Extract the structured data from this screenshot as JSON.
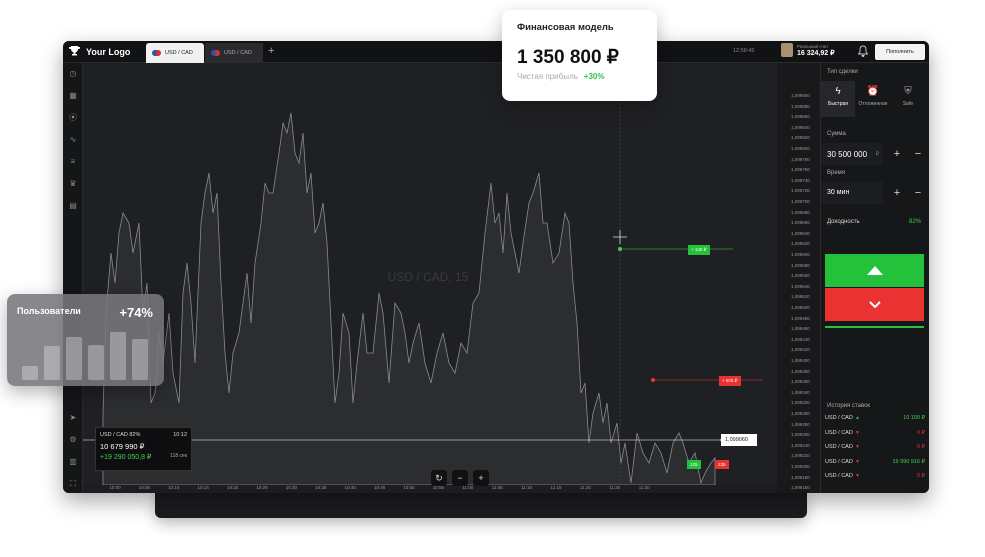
{
  "app": {
    "logo": "Your Logo",
    "tabs": [
      {
        "label": "USD / CAD"
      },
      {
        "label": "USD / CAD"
      }
    ],
    "time": "12:58:45",
    "account": {
      "type": "Реальный счет",
      "balance": "16 324,92 ₽"
    },
    "topup_label": "Пополнить"
  },
  "chart": {
    "watermark": "USD / CAD, 15",
    "current_price": "1,099060",
    "cursor_price": "1,099640",
    "y_labels": [
      "1,099900",
      "1,099880",
      "1,099860",
      "1,099840",
      "1,099820",
      "1,099800",
      "1,099780",
      "1,099760",
      "1,099740",
      "1,099720",
      "1,099700",
      "1,099680",
      "1,099660",
      "1,099640",
      "1,099620",
      "1,099600",
      "1,099580",
      "1,099560",
      "1,099540",
      "1,099520",
      "1,099500",
      "1,099480",
      "1,099460",
      "1,099440",
      "1,099420",
      "1,099400",
      "1,099380",
      "1,099360",
      "1,099340",
      "1,099320",
      "1,099300",
      "1,099280",
      "1,099260",
      "1,099240",
      "1,099220",
      "1,099200",
      "1,099180",
      "1,099160"
    ],
    "x_labels": [
      "10:00",
      "10:05",
      "10:10",
      "10:15",
      "10:20",
      "10:25",
      "10:30",
      "10:35",
      "10:40",
      "10:45",
      "10:50",
      "10:55",
      "11:00",
      "11:05",
      "11:10",
      "11:15",
      "11:20",
      "11:25",
      "11:30"
    ],
    "cursor_time": "11:02:45",
    "tag_green": "+ 130 ₽",
    "tag_red": "+ 500 ₽",
    "mini_tag_1": "125",
    "mini_tag_2": "235"
  },
  "ticker": {
    "pair": "USD / CAD",
    "pct": "82%",
    "time": "10:12",
    "amount": "10 679 990 ₽",
    "profit": "+19 290 050,8 ₽",
    "secs": "118 сек"
  },
  "panel": {
    "deal_type_label": "Тип сделки",
    "deal_types": [
      {
        "label": "Быстрая"
      },
      {
        "label": "Отложенная"
      },
      {
        "label": "Safe"
      }
    ],
    "amount_label": "Сумма",
    "amount_value": "30 500 000",
    "amount_currency": "₽",
    "time_label": "Время",
    "time_value": "30 мин",
    "yield_label": "Доходность",
    "yield_value": "82%",
    "history_label": "История ставок",
    "history": [
      {
        "pair": "USD / CAD",
        "dir": "up",
        "amount": "10 100 ₽",
        "color": "#3fd24f"
      },
      {
        "pair": "USD / CAD",
        "dir": "down",
        "amount": "0 ₽",
        "color": "#ea3232"
      },
      {
        "pair": "USD / CAD",
        "dir": "down",
        "amount": "0 ₽",
        "color": "#ea3232"
      },
      {
        "pair": "USD / CAD",
        "dir": "down",
        "amount": "19 990 916 ₽",
        "color": "#3fd24f"
      },
      {
        "pair": "USD / CAD",
        "dir": "down",
        "amount": "0 ₽",
        "color": "#ea3232"
      }
    ]
  },
  "card_fin": {
    "title": "Финансовая модель",
    "value": "1 350 800 ₽",
    "sub": "Чистая прибыль",
    "delta": "+30%"
  },
  "card_users": {
    "title": "Пользователи",
    "pct": "+74%",
    "bars": [
      0.2,
      0.48,
      0.62,
      0.5,
      0.68,
      0.58
    ]
  },
  "colors": {
    "up": "#24c13b",
    "down": "#ea3232",
    "bg": "#1c1d20"
  }
}
